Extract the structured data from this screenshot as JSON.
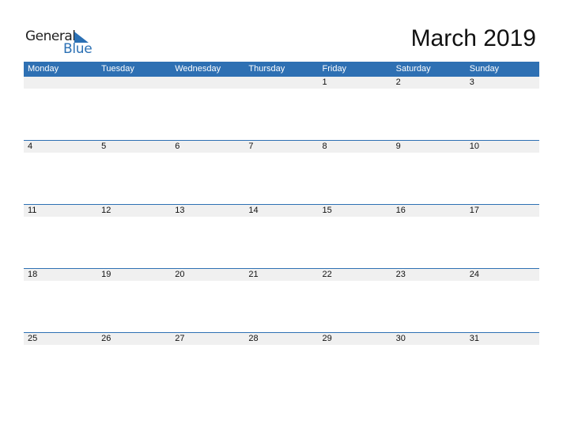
{
  "logo": {
    "general": "General",
    "blue": "Blue"
  },
  "title": "March 2019",
  "colors": {
    "accent": "#2e70b3",
    "strip": "#f0f0f0"
  },
  "weekdays": [
    "Monday",
    "Tuesday",
    "Wednesday",
    "Thursday",
    "Friday",
    "Saturday",
    "Sunday"
  ],
  "weeks": [
    [
      "",
      "",
      "",
      "",
      "1",
      "2",
      "3"
    ],
    [
      "4",
      "5",
      "6",
      "7",
      "8",
      "9",
      "10"
    ],
    [
      "11",
      "12",
      "13",
      "14",
      "15",
      "16",
      "17"
    ],
    [
      "18",
      "19",
      "20",
      "21",
      "22",
      "23",
      "24"
    ],
    [
      "25",
      "26",
      "27",
      "28",
      "29",
      "30",
      "31"
    ]
  ]
}
